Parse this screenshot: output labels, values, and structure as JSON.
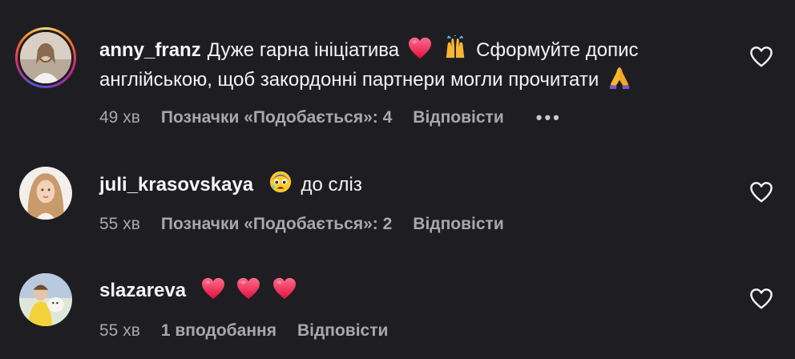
{
  "comments": [
    {
      "username": "anny_franz",
      "text_1": "Дуже гарна ініціатива",
      "text_2": "Сформуйте допис англійською, щоб закордонні партнери могли прочитати",
      "emojis": [
        "red-heart",
        "raising-hands",
        "folded-hands"
      ],
      "time": "49 хв",
      "likes": "Позначки «Подобається»: 4",
      "reply": "Відповісти",
      "more": "•••"
    },
    {
      "username": "juli_krasovskaya",
      "emojis": [
        "anxious-sweat-face"
      ],
      "text_1": "до сліз",
      "time": "55 хв",
      "likes": "Позначки «Подобається»: 2",
      "reply": "Відповісти"
    },
    {
      "username": "slazareva",
      "emojis": [
        "red-heart",
        "red-heart",
        "red-heart"
      ],
      "time": "55 хв",
      "likes": "1 вподобання",
      "reply": "Відповісти"
    }
  ],
  "colors": {
    "background": "#1e1e22",
    "text": "#f5f5f5",
    "meta": "#a8a8a8",
    "heart": "#ff2d55"
  }
}
